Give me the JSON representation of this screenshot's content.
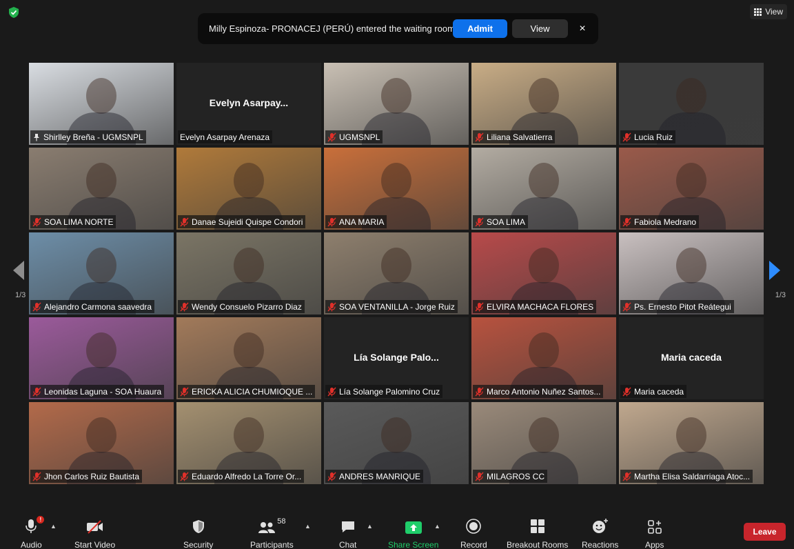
{
  "top": {
    "view_label": "View"
  },
  "notification": {
    "message": "Milly Espinoza- PRONACEJ (PERÚ) entered the waiting room",
    "admit_label": "Admit",
    "view_label": "View",
    "close_glyph": "×"
  },
  "nav": {
    "page_left": "1/3",
    "page_right": "1/3"
  },
  "tiles": [
    {
      "name": "Shirlley Breña - UGMSNPL",
      "center_name": "",
      "bg": "#d9dde2",
      "icon": "pin-icon"
    },
    {
      "name": "Evelyn Asarpay Arenaza",
      "center_name": "Evelyn  Asarpay...",
      "bg": "#232323",
      "icon": ""
    },
    {
      "name": "UGMSNPL",
      "center_name": "",
      "bg": "#c9c0b4",
      "icon": "mute-icon"
    },
    {
      "name": "Liliana Salvatierra",
      "center_name": "",
      "bg": "#c9ad86",
      "icon": "mute-icon"
    },
    {
      "name": "Lucia Ruiz",
      "center_name": "",
      "bg": "#3a3a3a",
      "icon": "mute-icon"
    },
    {
      "name": "SOA LIMA NORTE",
      "center_name": "",
      "bg": "#8a7d70",
      "icon": "mute-icon"
    },
    {
      "name": "Danae Sujeidi Quispe Condori",
      "center_name": "",
      "bg": "#b07a3a",
      "icon": "mute-icon"
    },
    {
      "name": "ANA MARIA",
      "center_name": "",
      "bg": "#c96f3a",
      "icon": "mute-icon"
    },
    {
      "name": "SOA LIMA",
      "center_name": "",
      "bg": "#b3aca2",
      "icon": "mute-icon"
    },
    {
      "name": "Fabiola Medrano",
      "center_name": "",
      "bg": "#9a5a4a",
      "icon": "mute-icon"
    },
    {
      "name": "Alejandro Carmona saavedra",
      "center_name": "",
      "bg": "#6d8ea8",
      "icon": "mute-icon"
    },
    {
      "name": "Wendy Consuelo Pizarro Diaz",
      "center_name": "",
      "bg": "#7b7565",
      "icon": "mute-icon"
    },
    {
      "name": "SOA VENTANILLA - Jorge Ruiz",
      "center_name": "",
      "bg": "#8e7f6d",
      "icon": "mute-icon"
    },
    {
      "name": "ELVIRA MACHACA FLORES",
      "center_name": "",
      "bg": "#b84a4a",
      "icon": "mute-icon"
    },
    {
      "name": "Ps. Ernesto Pitot Reátegui",
      "center_name": "",
      "bg": "#c9c0c0",
      "icon": "mute-icon"
    },
    {
      "name": "Leonidas Laguna - SOA Huaura",
      "center_name": "",
      "bg": "#9b5a9b",
      "icon": "mute-icon"
    },
    {
      "name": "ERICKA ALICIA CHUMIOQUE ...",
      "center_name": "",
      "bg": "#a27a5a",
      "icon": "mute-icon"
    },
    {
      "name": "Lía Solange Palomino Cruz",
      "center_name": "Lía  Solange  Palo...",
      "bg": "#232323",
      "icon": "mute-icon"
    },
    {
      "name": "Marco Antonio Nuñez Santos...",
      "center_name": "",
      "bg": "#b8523e",
      "icon": "mute-icon"
    },
    {
      "name": "Maria caceda",
      "center_name": "Maria caceda",
      "bg": "#232323",
      "icon": "mute-icon"
    },
    {
      "name": "Jhon Carlos Ruiz Bautista",
      "center_name": "",
      "bg": "#b36a4a",
      "icon": "mute-icon"
    },
    {
      "name": "Eduardo Alfredo La Torre Or...",
      "center_name": "",
      "bg": "#a49070",
      "icon": "mute-icon"
    },
    {
      "name": "ANDRES MANRIQUE",
      "center_name": "",
      "bg": "#5a5a5a",
      "icon": "mute-icon"
    },
    {
      "name": "MILAGROS CC",
      "center_name": "",
      "bg": "#9a8a7a",
      "icon": "mute-icon"
    },
    {
      "name": "Martha Elisa Saldarriaga Atoc...",
      "center_name": "",
      "bg": "#c0a88e",
      "icon": "mute-icon"
    }
  ],
  "toolbar": {
    "audio": "Audio",
    "start_video": "Start Video",
    "security": "Security",
    "participants": "Participants",
    "participants_count": "58",
    "chat": "Chat",
    "share_screen": "Share Screen",
    "record": "Record",
    "breakout_rooms": "Breakout Rooms",
    "reactions": "Reactions",
    "apps": "Apps",
    "leave": "Leave",
    "audio_badge": "!"
  },
  "colors": {
    "accent_blue": "#0e71eb",
    "leave_red": "#c8252c",
    "share_green": "#1fcd6a",
    "active_speaker": "#d8e85a"
  }
}
